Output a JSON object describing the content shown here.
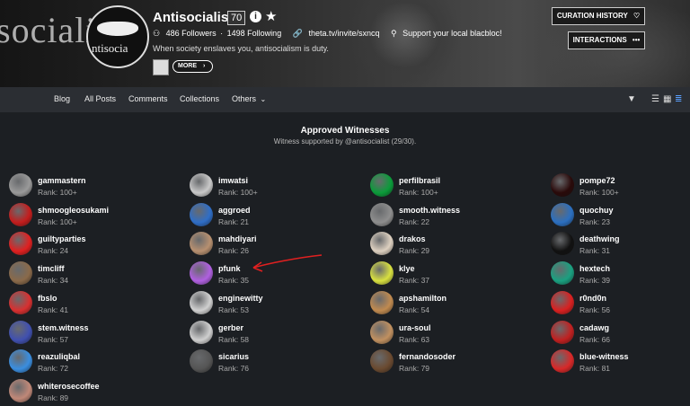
{
  "profile": {
    "banner_word": "socialis",
    "avatar_word": "ntisocia",
    "name": "Antisocialist",
    "reputation": "70",
    "followers": "486 Followers",
    "following": "1498 Following",
    "link": "theta.tv/invite/sxncq",
    "location": "Support your local blacbloc!",
    "tagline": "When society enslaves you, antisocialism is duty.",
    "more_label": "MORE",
    "curation_history_label": "CURATION HISTORY",
    "interactions_label": "INTERACTIONS",
    "separator": "·"
  },
  "nav": {
    "items": [
      "Blog",
      "All Posts",
      "Comments",
      "Collections",
      "Others"
    ]
  },
  "section": {
    "title": "Approved Witnesses",
    "subtitle": "Witness supported by @antisocialist (29/30)."
  },
  "witnesses": [
    {
      "name": "gammastern",
      "rank": "Rank: 100+",
      "color": "#9a9a9a"
    },
    {
      "name": "imwatsi",
      "rank": "Rank: 100+",
      "color": "#c9c9c9"
    },
    {
      "name": "perfilbrasil",
      "rank": "Rank: 100+",
      "color": "#0b9b3a"
    },
    {
      "name": "pompe72",
      "rank": "Rank: 100+",
      "color": "#2a0a0a"
    },
    {
      "name": "shmoogleosukami",
      "rank": "Rank: 100+",
      "color": "#c41d1d"
    },
    {
      "name": "aggroed",
      "rank": "Rank: 21",
      "color": "#2f6ec7"
    },
    {
      "name": "smooth.witness",
      "rank": "Rank: 22",
      "color": "#8e8e8e"
    },
    {
      "name": "quochuy",
      "rank": "Rank: 23",
      "color": "#2b6fc0"
    },
    {
      "name": "guiltyparties",
      "rank": "Rank: 24",
      "color": "#e02020"
    },
    {
      "name": "mahdiyari",
      "rank": "Rank: 26",
      "color": "#b79070"
    },
    {
      "name": "drakos",
      "rank": "Rank: 29",
      "color": "#ddd0c0"
    },
    {
      "name": "deathwing",
      "rank": "Rank: 31",
      "color": "#111111"
    },
    {
      "name": "timcliff",
      "rank": "Rank: 34",
      "color": "#8a6a4a"
    },
    {
      "name": "pfunk",
      "rank": "Rank: 35",
      "color": "#b060e0"
    },
    {
      "name": "klye",
      "rank": "Rank: 37",
      "color": "#d8e040"
    },
    {
      "name": "hextech",
      "rank": "Rank: 39",
      "color": "#1aa080"
    },
    {
      "name": "fbslo",
      "rank": "Rank: 41",
      "color": "#d83030"
    },
    {
      "name": "enginewitty",
      "rank": "Rank: 53",
      "color": "#d0d0d0"
    },
    {
      "name": "apshamilton",
      "rank": "Rank: 54",
      "color": "#c08a50"
    },
    {
      "name": "r0nd0n",
      "rank": "Rank: 56",
      "color": "#d82020"
    },
    {
      "name": "stem.witness",
      "rank": "Rank: 57",
      "color": "#4050b0"
    },
    {
      "name": "gerber",
      "rank": "Rank: 58",
      "color": "#cfcfcf"
    },
    {
      "name": "ura-soul",
      "rank": "Rank: 63",
      "color": "#c09060"
    },
    {
      "name": "cadawg",
      "rank": "Rank: 66",
      "color": "#c02020"
    },
    {
      "name": "reazuliqbal",
      "rank": "Rank: 72",
      "color": "#3a8ee0"
    },
    {
      "name": "sicarius",
      "rank": "Rank: 76",
      "color": "#555555"
    },
    {
      "name": "fernandosoder",
      "rank": "Rank: 79",
      "color": "#6a4a30"
    },
    {
      "name": "blue-witness",
      "rank": "Rank: 81",
      "color": "#d82828"
    },
    {
      "name": "whiterosecoffee",
      "rank": "Rank: 89",
      "color": "#c08878"
    }
  ]
}
